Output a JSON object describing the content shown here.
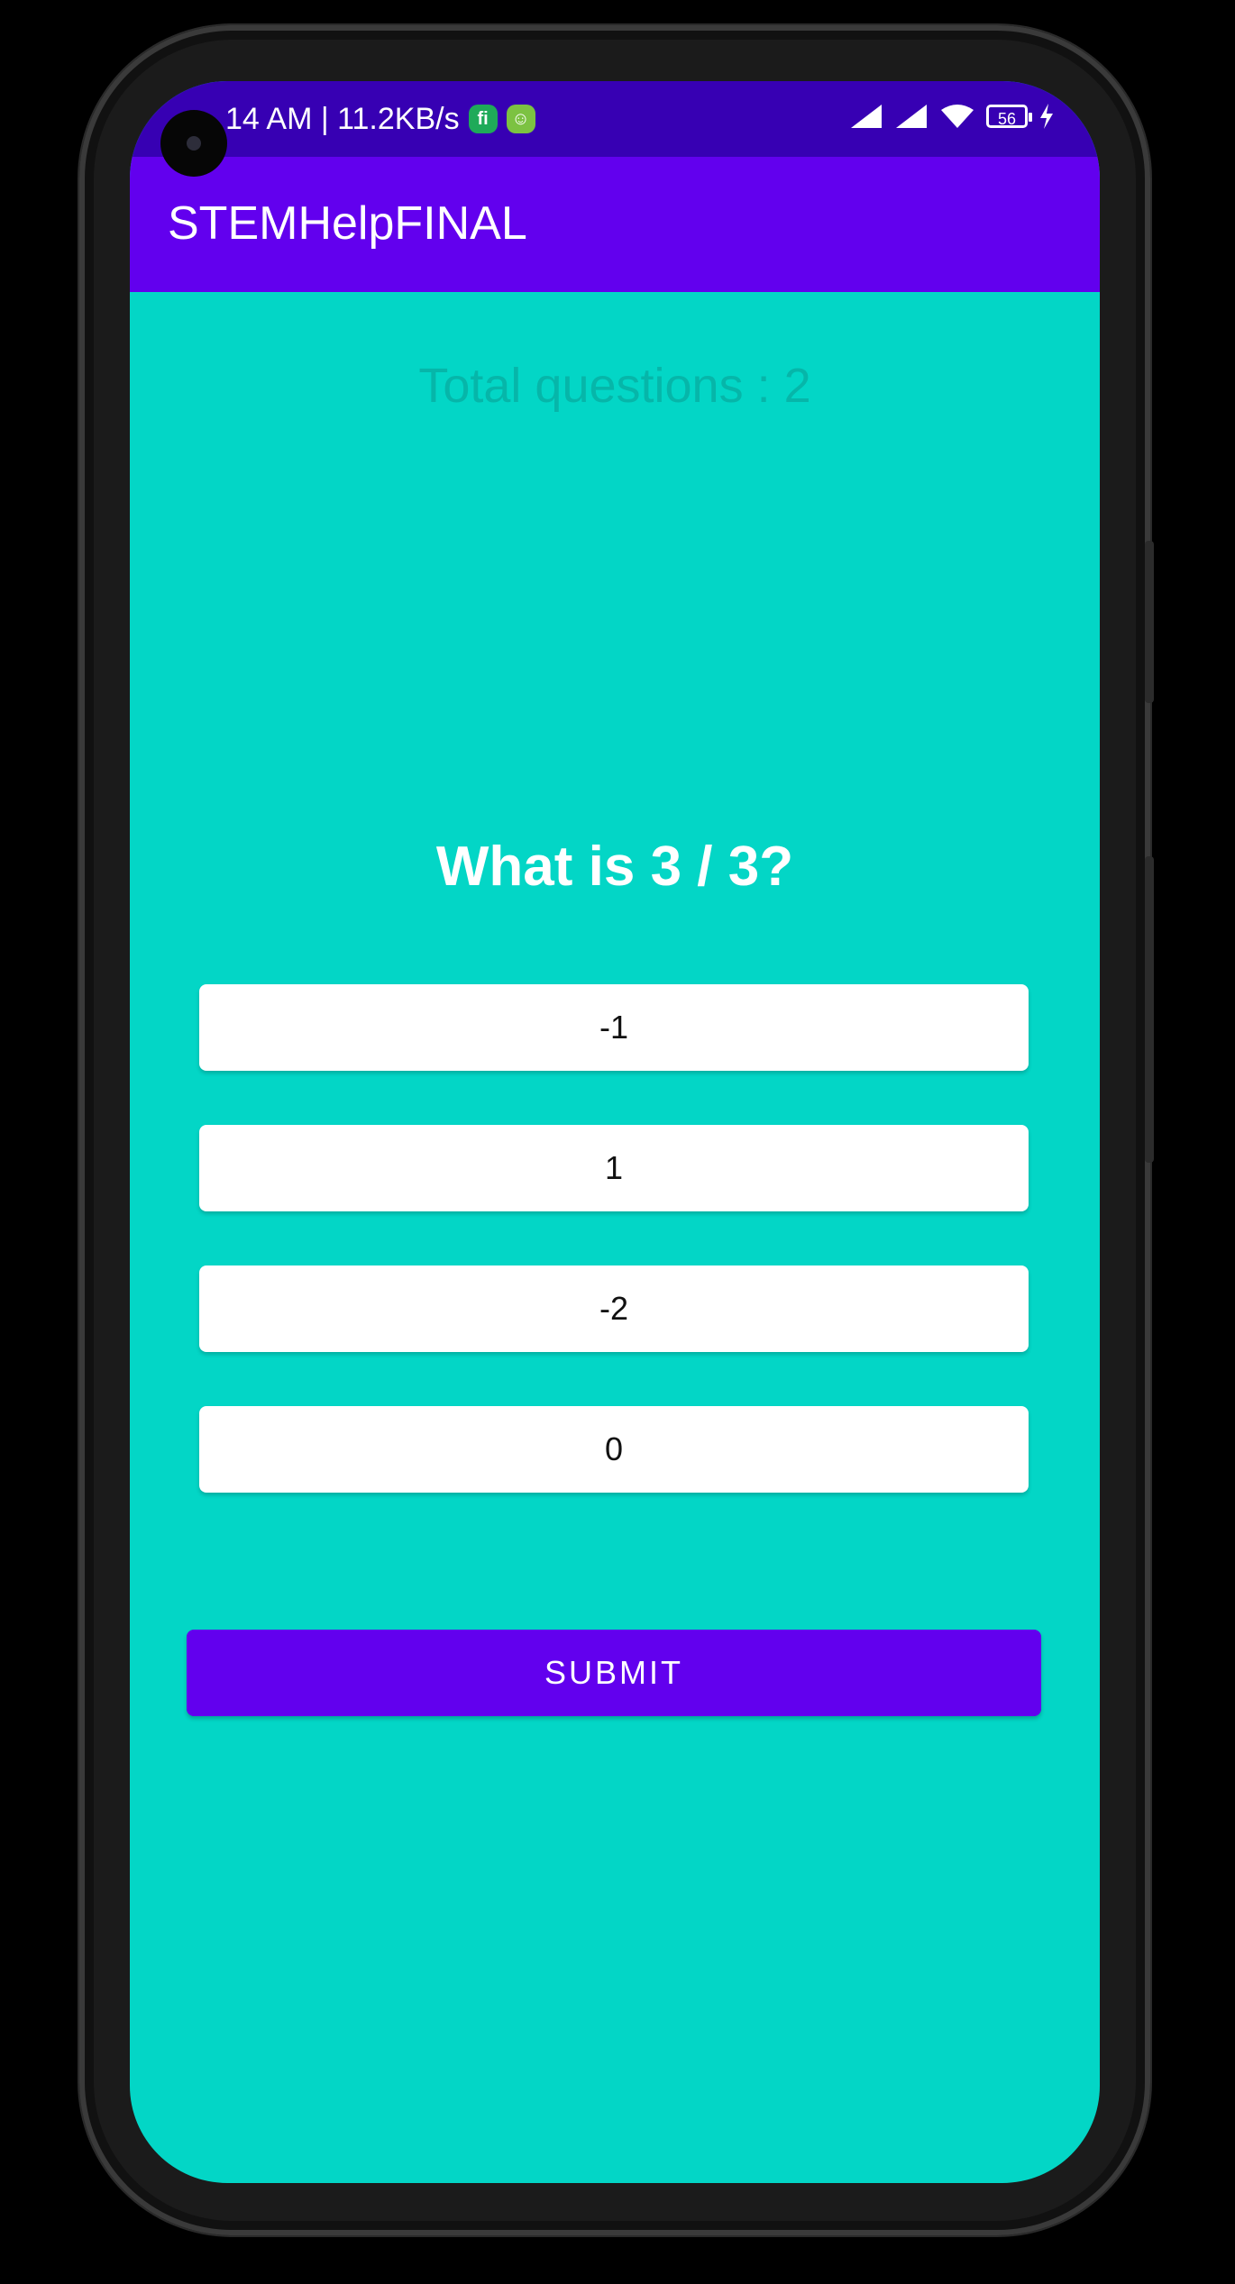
{
  "status_bar": {
    "time_and_speed": "14 AM | 11.2KB/s",
    "notif_icons": [
      "fi-icon",
      "android-icon"
    ],
    "notif_icon_labels": [
      "fi",
      "☺"
    ],
    "battery_level": "56",
    "colors": {
      "background": "#3700b3"
    }
  },
  "app_bar": {
    "title": "STEMHelpFINAL",
    "colors": {
      "background": "#6200ee"
    }
  },
  "quiz": {
    "total_questions": "Total questions : 2",
    "question": "What is 3 / 3?",
    "options": [
      "-1",
      "1",
      "-2",
      "0"
    ],
    "submit_label": "SUBMIT"
  },
  "colors": {
    "screen_background": "#03d6c6",
    "accent": "#6200ee",
    "option_background": "#ffffff"
  }
}
